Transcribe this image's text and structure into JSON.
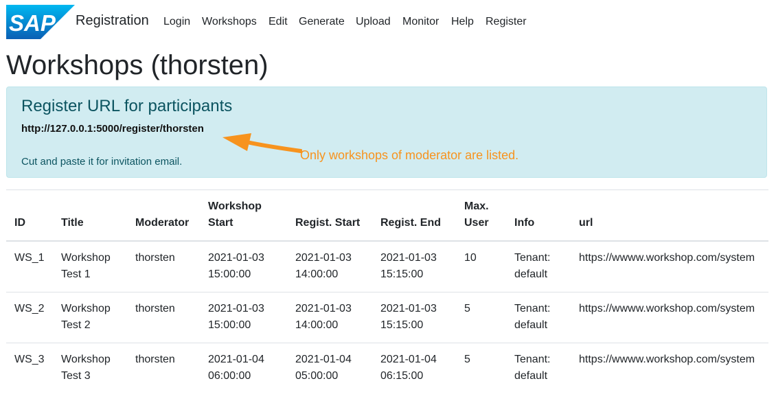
{
  "navbar": {
    "logo_text": "SAP",
    "brand": "Registration",
    "items": [
      {
        "label": "Login"
      },
      {
        "label": "Workshops"
      },
      {
        "label": "Edit"
      },
      {
        "label": "Generate"
      },
      {
        "label": "Upload"
      },
      {
        "label": "Monitor"
      },
      {
        "label": "Help"
      },
      {
        "label": "Register"
      }
    ]
  },
  "page": {
    "title": "Workshops (thorsten)"
  },
  "alert": {
    "heading": "Register URL for participants",
    "url": "http://127.0.0.1:5000/register/thorsten",
    "note": "Cut and paste it for invitation email."
  },
  "annotation": {
    "text": "Only workshops of moderator are listed.",
    "color": "#f7931e"
  },
  "table": {
    "headers": {
      "id": "ID",
      "title": "Title",
      "moderator": "Moderator",
      "workshop_start": "Workshop Start",
      "regist_start": "Regist. Start",
      "regist_end": "Regist. End",
      "max_user": "Max. User",
      "info": "Info",
      "url": "url"
    },
    "rows": [
      {
        "id": "WS_1",
        "title": "Workshop Test 1",
        "moderator": "thorsten",
        "workshop_start": "2021-01-03 15:00:00",
        "regist_start": "2021-01-03 14:00:00",
        "regist_end": "2021-01-03 15:15:00",
        "max_user": "10",
        "info": "Tenant: default",
        "url": "https://wwww.workshop.com/system"
      },
      {
        "id": "WS_2",
        "title": "Workshop Test 2",
        "moderator": "thorsten",
        "workshop_start": "2021-01-03 15:00:00",
        "regist_start": "2021-01-03 14:00:00",
        "regist_end": "2021-01-03 15:15:00",
        "max_user": "5",
        "info": "Tenant: default",
        "url": "https://wwww.workshop.com/system"
      },
      {
        "id": "WS_3",
        "title": "Workshop Test 3",
        "moderator": "thorsten",
        "workshop_start": "2021-01-04 06:00:00",
        "regist_start": "2021-01-04 05:00:00",
        "regist_end": "2021-01-04 06:15:00",
        "max_user": "5",
        "info": "Tenant: default",
        "url": "https://wwww.workshop.com/system"
      }
    ]
  },
  "colors": {
    "sap_blue": "#0a6ed1",
    "alert_bg": "#d1ecf1",
    "alert_text": "#0c5460"
  }
}
